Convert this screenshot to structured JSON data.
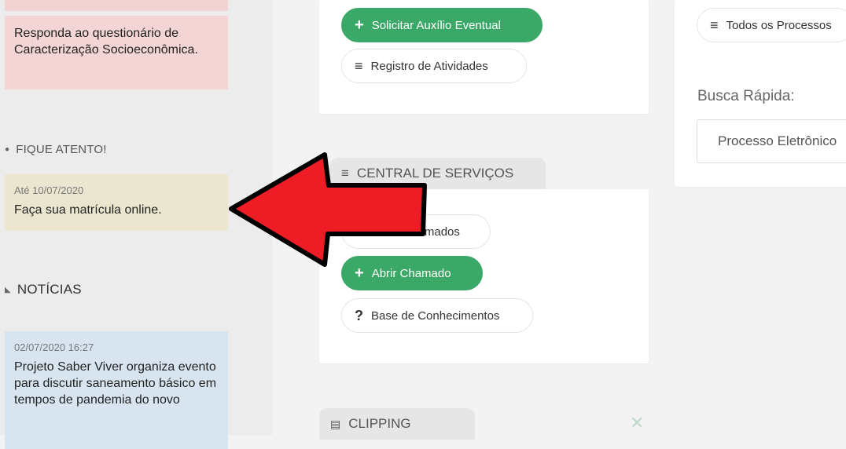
{
  "left": {
    "alert_pink": "Responda ao questionário de Caracterização Socioeconômica.",
    "attention_title": "FIQUE ATENTO!",
    "attention_date": "Até 10/07/2020",
    "attention_text": "Faça sua matrícula online.",
    "news_title": "NOTÍCIAS",
    "news_date": "02/07/2020 16:27",
    "news_text": "Projeto Saber Viver organiza evento para discutir saneamento básico em tempos de pandemia do novo"
  },
  "middle": {
    "solicitar": "Solicitar Auxílio Eventual",
    "registro": "Registro de Atividades",
    "central_title": "CENTRAL DE SERVIÇOS",
    "meus_chamados": "Meus Chamados",
    "abrir": "Abrir Chamado",
    "base": "Base de Conhecimentos",
    "clipping": "CLIPPING"
  },
  "right": {
    "todos": "Todos os Processos",
    "busca_label": "Busca Rápida:",
    "search_placeholder": "Processo Eletrônico"
  },
  "icons": {
    "plus": "+",
    "list": "≡",
    "question": "?",
    "close": "✕"
  },
  "colors": {
    "green": "#3aa866",
    "arrow_red": "#ee1c24"
  }
}
